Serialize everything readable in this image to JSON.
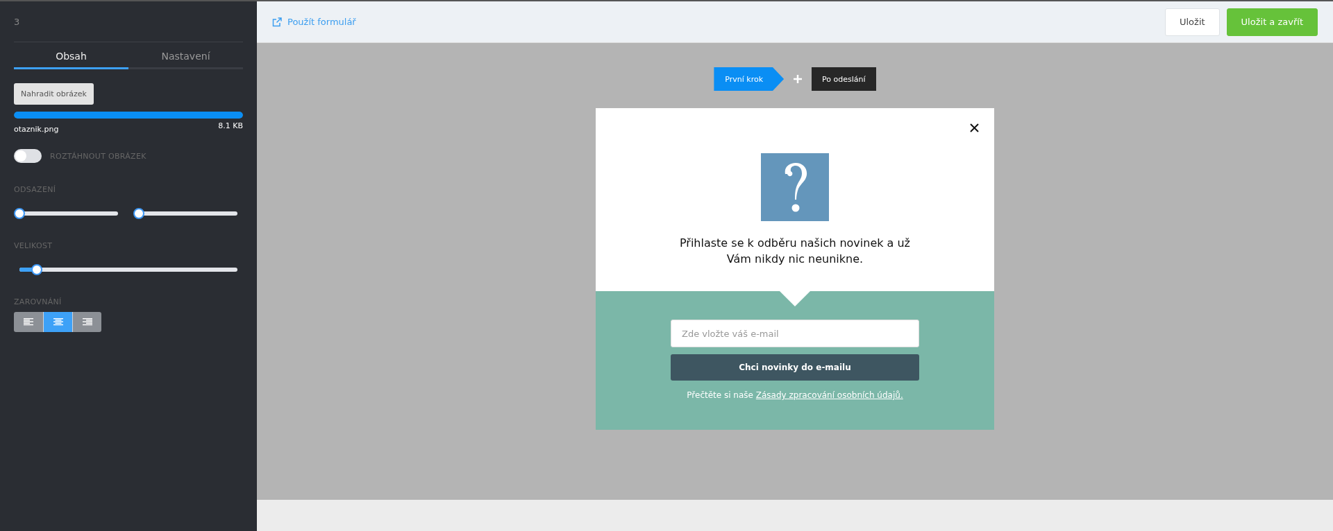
{
  "sidebar": {
    "title": "3",
    "tabs": [
      {
        "label": "Obsah",
        "selected": true
      },
      {
        "label": "Nastavení",
        "selected": false
      }
    ],
    "replace_button": "Nahradit obrázek",
    "upload": {
      "level": 1,
      "file_name": "otaznik.png",
      "file_size": "8.1 KB"
    },
    "stretch_toggle": {
      "label": "ROZTÁHNOUT OBRÁZEK",
      "on": false
    },
    "padding": {
      "label": "ODSAZENÍ",
      "sliders": [
        {
          "level": 0
        },
        {
          "level": 0
        }
      ]
    },
    "size": {
      "label": "VELIKOST",
      "level": 0.08
    },
    "alignment": {
      "label": "ZAROVNÁNÍ",
      "options": [
        {
          "kind": "left",
          "selected": false
        },
        {
          "kind": "center",
          "selected": true
        },
        {
          "kind": "right",
          "selected": false
        }
      ]
    }
  },
  "toolbar": {
    "use_form_link": "Použít formulář",
    "buttons": [
      {
        "label": "Uložit",
        "kind": "secondary"
      },
      {
        "label": "Uložit a zavřít",
        "kind": "primary"
      }
    ]
  },
  "steps": [
    {
      "label": "První krok",
      "selected": true
    },
    {
      "label": "Po odeslání",
      "selected": false
    }
  ],
  "popup": {
    "message": "Přihlaste se k odběru našich novinek a už Vám nikdy nic neunikne.",
    "email_placeholder": "Zde vložte váš e-mail",
    "submit_button": "Chci novinky do e-mailu",
    "privacy_text": "Přečtěte si naše",
    "privacy_link": "Zásady zpracování osobních údajů."
  }
}
